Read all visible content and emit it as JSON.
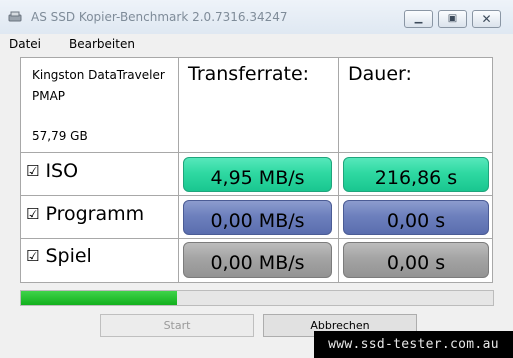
{
  "window": {
    "title": "AS SSD Kopier-Benchmark 2.0.7316.34247",
    "controls": [
      "minimize",
      "maximize",
      "close"
    ]
  },
  "menu": {
    "items": [
      "Datei",
      "Bearbeiten"
    ]
  },
  "drive": {
    "name_line1": "Kingston DataTraveler",
    "name_line2": "PMAP",
    "size": "57,79 GB"
  },
  "columns": {
    "transfer": "Transferrate:",
    "duration": "Dauer:"
  },
  "rows": [
    {
      "label": "ISO",
      "checked": "☑",
      "rate": "4,95 MB/s",
      "time": "216,86 s",
      "status_color": "#2fd9a2"
    },
    {
      "label": "Programm",
      "checked": "☑",
      "rate": "0,00 MB/s",
      "time": "0,00 s",
      "status_color": "#6d80bd"
    },
    {
      "label": "Spiel",
      "checked": "☑",
      "rate": "0,00 MB/s",
      "time": "0,00 s",
      "status_color": "#a4a4a4"
    }
  ],
  "progress": {
    "fraction": 0.33,
    "color": "#12b01d"
  },
  "buttons": {
    "start": "Start",
    "cancel": "Abbrechen"
  },
  "watermark": "www.ssd-tester.com.au"
}
